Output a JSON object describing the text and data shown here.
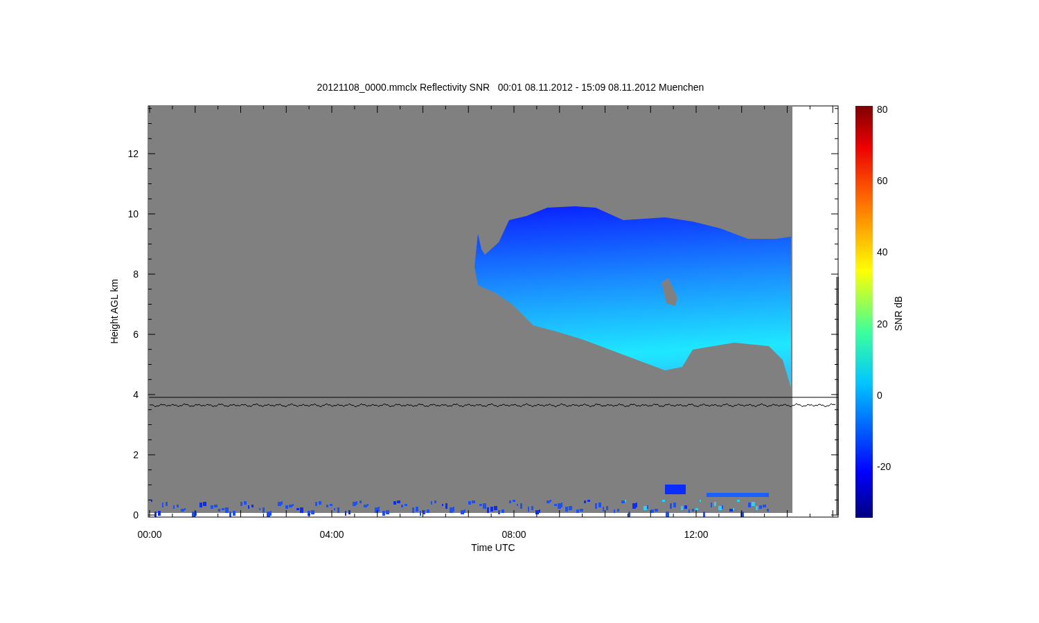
{
  "title": "20121108_0000.mmclx Reflectivity SNR   00:01 08.11.2012 - 15:09 08.11.2012 Muenchen",
  "plot": {
    "xlabel": "Time UTC",
    "ylabel": "Height AGL km",
    "xticks": [
      "00:00",
      "04:00",
      "08:00",
      "12:00"
    ],
    "yticks": [
      "12",
      "10",
      "8",
      "6",
      "4",
      "2",
      "0"
    ]
  },
  "colorbar": {
    "label": "SNR dB",
    "ticks": [
      "80",
      "60",
      "40",
      "20",
      "0",
      "-20"
    ]
  }
}
